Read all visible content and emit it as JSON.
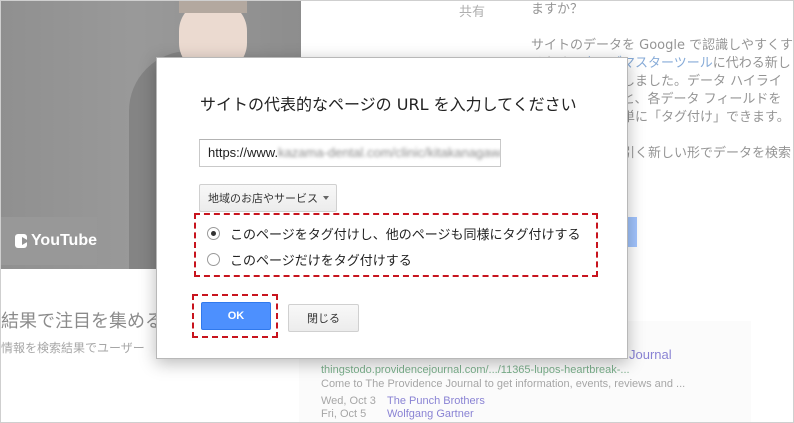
{
  "background": {
    "youtube_label": "YouTube",
    "share_label": "共有",
    "right_column": {
      "line1": "ますか？",
      "para2_pre": "サイトのデータを Google で認識しやすくするため、",
      "para2_link": "ウェブマスターツール",
      "para2_post": "に代わる新しいツールを開発しました。データ ハイライターを使用すると、各データ フィールドを簡単な操作で簡単に「タグ付け」できます。",
      "para3": "ちょっと人目を引く新しい形でデータを検索結果に表"
    },
    "heading": "結果で注目を集める",
    "subtext": "情報を検索結果でユーザー",
    "result": {
      "title": "Journal",
      "url": "thingstodo.providencejournal.com/.../11365-lupos-heartbreak-...",
      "description": "Come to The Providence Journal to get information, events, reviews and ...",
      "event1_date": "Wed, Oct 3",
      "event1_name": "The Punch Brothers",
      "event2_date": "Fri, Oct 5",
      "event2_name": "Wolfgang Gartner"
    }
  },
  "dialog": {
    "title": "サイトの代表的なページの URL を入力してください",
    "url_prefix": "https://www.",
    "url_blurred": "kazama-dental.com/clinic/kitakanagawa",
    "category_dropdown": "地域のお店やサービス",
    "radio_options": [
      {
        "label": "このページをタグ付けし、他のページも同様にタグ付けする",
        "selected": true
      },
      {
        "label": "このページだけをタグ付けする",
        "selected": false
      }
    ],
    "ok_button": "OK",
    "close_button": "閉じる"
  },
  "colors": {
    "primary_button": "#4d90fe",
    "highlight_dash": "#c8141e"
  }
}
